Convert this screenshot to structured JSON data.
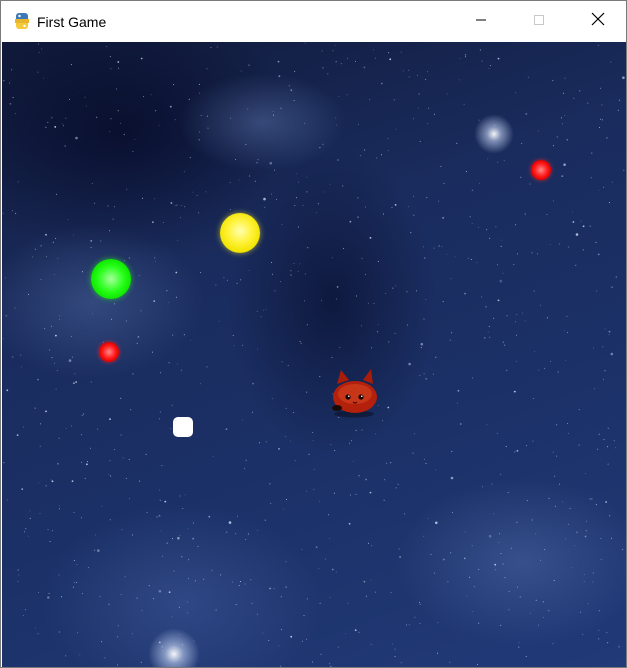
{
  "window": {
    "title": "First Game",
    "app_icon": "python-icon",
    "controls": {
      "minimize": "minimize-icon",
      "maximize": "maximize-icon",
      "close": "close-icon"
    }
  },
  "game": {
    "background": "starry-night-sky",
    "player": {
      "sprite": "red-cat-creature",
      "color": "#b3200c"
    },
    "orbs": [
      {
        "name": "red-orb-top-right",
        "color": "#ff1c1c"
      },
      {
        "name": "yellow-orb",
        "color": "#fff23a"
      },
      {
        "name": "green-orb",
        "color": "#28ff1a"
      },
      {
        "name": "red-orb-left",
        "color": "#ff1c1c"
      },
      {
        "name": "white-orb",
        "color": "#ffffff"
      }
    ]
  }
}
